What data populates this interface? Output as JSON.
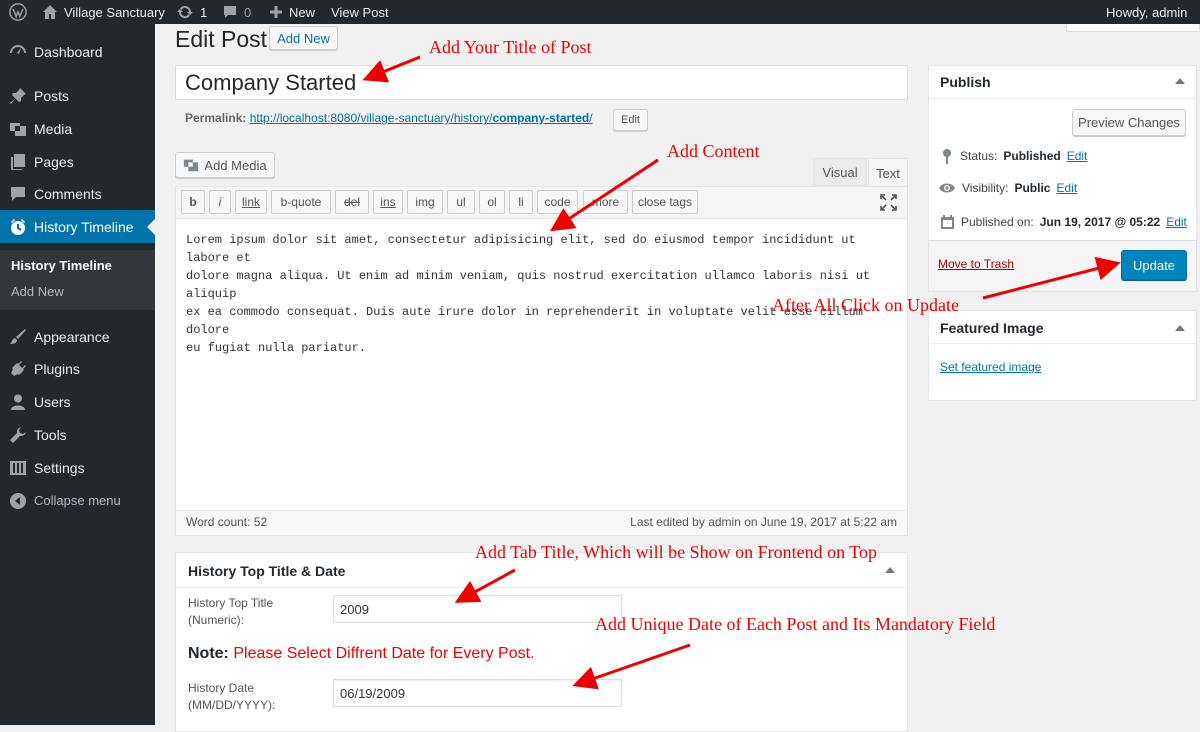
{
  "admin_bar": {
    "site_name": "Village Sanctuary",
    "updates_count": "1",
    "comments_count": "0",
    "new_label": "New",
    "view_post_label": "View Post",
    "howdy": "Howdy, admin"
  },
  "sidebar": {
    "items": [
      {
        "label": "Dashboard",
        "icon": "dashboard-icon"
      },
      {
        "label": "Posts",
        "icon": "pin-icon"
      },
      {
        "label": "Media",
        "icon": "media-icon"
      },
      {
        "label": "Pages",
        "icon": "pages-icon"
      },
      {
        "label": "Comments",
        "icon": "comment-icon"
      },
      {
        "label": "History Timeline",
        "icon": "clock-icon"
      },
      {
        "label": "Appearance",
        "icon": "brush-icon"
      },
      {
        "label": "Plugins",
        "icon": "plug-icon"
      },
      {
        "label": "Users",
        "icon": "user-icon"
      },
      {
        "label": "Tools",
        "icon": "wrench-icon"
      },
      {
        "label": "Settings",
        "icon": "sliders-icon"
      },
      {
        "label": "Collapse menu",
        "icon": "collapse-icon"
      }
    ],
    "submenu": [
      "History Timeline",
      "Add New"
    ]
  },
  "page": {
    "title": "Edit Post",
    "add_new": "Add New",
    "post_title": "Company Started",
    "permalink_label": "Permalink:",
    "permalink_base": "http://localhost:8080/village-sanctuary/history/",
    "permalink_slug": "company-started",
    "permalink_end": "/",
    "permalink_edit": "Edit"
  },
  "editor": {
    "add_media": "Add Media",
    "tab_visual": "Visual",
    "tab_text": "Text",
    "quicktags": [
      "b",
      "i",
      "link",
      "b-quote",
      "del",
      "ins",
      "img",
      "ul",
      "ol",
      "li",
      "code",
      "more",
      "close tags"
    ],
    "content_lines": [
      "Lorem ipsum dolor sit amet, consectetur adipisicing elit, sed do eiusmod tempor incididunt ut labore et",
      "dolore magna aliqua. Ut enim ad minim veniam, quis nostrud exercitation ullamco laboris nisi ut aliquip",
      "ex ea commodo consequat. Duis aute irure dolor in reprehenderit in voluptate velit esse cillum dolore",
      "eu fugiat nulla pariatur."
    ],
    "word_count": "Word count: 52",
    "last_edited": "Last edited by admin on June 19, 2017 at 5:22 am"
  },
  "publish": {
    "title": "Publish",
    "preview": "Preview Changes",
    "status_label": "Status:",
    "status_value": "Published",
    "visibility_label": "Visibility:",
    "visibility_value": "Public",
    "published_label": "Published on:",
    "published_value": "Jun 19, 2017 @ 05:22",
    "edit": "Edit",
    "trash": "Move to Trash",
    "update": "Update"
  },
  "featured": {
    "title": "Featured Image",
    "link": "Set featured image"
  },
  "history_box": {
    "title": "History Top Title & Date",
    "top_title_label": [
      "History Top Title",
      "(Numeric):"
    ],
    "top_title_value": "2009",
    "note_label": "Note:",
    "note_text": "Please Select Diffrent Date for Every Post.",
    "date_label": [
      "History Date",
      "(MM/DD/YYYY):"
    ],
    "date_value": "06/19/2009"
  },
  "annotations": {
    "title": "Add Your Title of Post",
    "content": "Add Content",
    "update": "After All Click on Update",
    "tab_title": "Add Tab Title, Which will be Show on Frontend on Top",
    "date": "Add Unique Date of Each Post and Its Mandatory Field"
  },
  "colors": {
    "accent": "#0073aa",
    "annotation": "#e00000",
    "sidebar": "#23282d",
    "trash": "#a00"
  }
}
